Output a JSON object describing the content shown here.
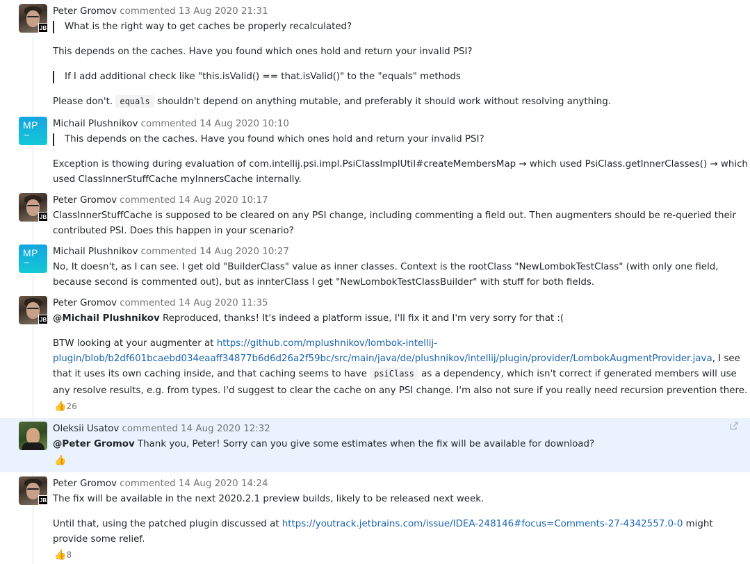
{
  "comments": [
    {
      "author": "Peter Gromov",
      "meta": "commented 13 Aug 2020 21:31",
      "badge": "JB",
      "quote1": "What is the right way to get caches be properly recalculated?",
      "p1": "This depends on the caches. Have you found which ones hold and return your invalid PSI?",
      "quote2": "If I add additional check like \"this.isValid() == that.isValid()\" to the \"equals\" methods",
      "p2_before": "Please don't.",
      "p2_code": "equals",
      "p2_after": "shouldn't depend on anything mutable, and preferably it should work without resolving anything."
    },
    {
      "author": "Michail Plushnikov",
      "meta": "commented 14 Aug 2020 10:10",
      "initials": "MP",
      "quote1": "This depends on the caches. Have you found which ones hold and return your invalid PSI?",
      "l1": "Exception is thowing during evaluation of com.intellij.psi.impl.PsiClassImplUtil#createMembersMap → which used PsiClass.getInnerClasses() → which",
      "l2": "used ClassInnerStuffCache myInnersCache internally."
    },
    {
      "author": "Peter Gromov",
      "meta": "commented 14 Aug 2020 10:17",
      "badge": "JB",
      "l1": "ClassInnerStuffCache is supposed to be cleared on any PSI change, including commenting a field out. Then augmenters should be re-queried their",
      "l2": "contributed PSI. Does this happen in your scenario?"
    },
    {
      "author": "Michail Plushnikov",
      "meta": "commented 14 Aug 2020 10:27",
      "initials": "MP",
      "l1": "No, It doesn't, as I can see. I get old \"BuilderClass\" value as inner classes. Context is the rootClass \"NewLombokTestClass\" (with only one field,",
      "l2": "because second is commented out), but as innterClass I get \"NewLombokTestClassBuilder\" with stuff for both fields."
    },
    {
      "author": "Peter Gromov",
      "meta": "commented 14 Aug 2020 11:35",
      "badge": "JB",
      "mention": "@Michail Plushnikov",
      "l1": "Reproduced, thanks! It's indeed a platform issue, I'll fix it and I'm very sorry for that :(",
      "l2_before": "BTW looking at your augmenter at",
      "link1a": "https://github.com/mplushnikov/lombok-intellij-",
      "link1b": "plugin/blob/b2df601bcaebd034eaaff34877b6d6d26a2f59bc/src/main/java/de/plushnikov/intellij/plugin/provider/LombokAugmentProvider.java",
      "l3_after_link": ", I see",
      "l4_before": "that it uses its own caching inside, and that caching seems to have",
      "l4_code": "psiClass",
      "l4_after": "as a dependency, which isn't correct if generated members will use",
      "l5": "any resolve results, e.g. from types. I'd suggest to clear the cache on any PSI change. I'm also not sure if you really need recursion prevention there.",
      "reaction_count": "26"
    },
    {
      "author": "Oleksii Usatov",
      "meta": "commented 14 Aug 2020 12:32",
      "mention": "@Peter Gromov",
      "l1": "Thank you, Peter! Sorry can you give some estimates when the fix will be available for download?"
    },
    {
      "author": "Peter Gromov",
      "meta": "commented 14 Aug 2020 14:24",
      "badge": "JB",
      "l1": "The fix will be available in the next 2020.2.1 preview builds, likely to be released next week.",
      "l2_before": "Until that, using the patched plugin discussed at",
      "link": "https://youtrack.jetbrains.com/issue/IDEA-248146#focus=Comments-27-4342557.0-0",
      "l2_after": "might",
      "l3": "provide some relief.",
      "reaction_count": "8"
    }
  ],
  "icons": {
    "reaction": "thumbs-up-icon",
    "share": "share-link-icon"
  },
  "colors": {
    "link": "#1a64b0",
    "highlight": "#eaf3fd",
    "avatar_gradient": "#14a5e0"
  }
}
